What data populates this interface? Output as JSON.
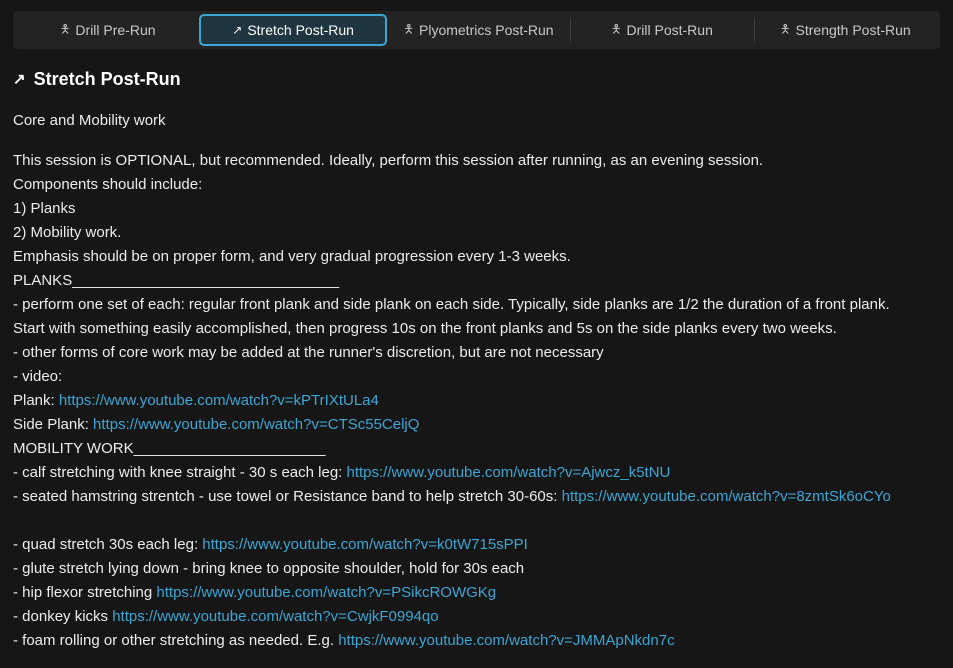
{
  "tabs": [
    {
      "label": "Drill Pre-Run",
      "icon": "runner-icon",
      "glyph": "🯅"
    },
    {
      "label": "Stretch Post-Run",
      "icon": "stretch-icon",
      "glyph": "↗"
    },
    {
      "label": "Plyometrics Post-Run",
      "icon": "jump-icon",
      "glyph": "🯅"
    },
    {
      "label": "Drill Post-Run",
      "icon": "runner-icon",
      "glyph": "🯅"
    },
    {
      "label": "Strength Post-Run",
      "icon": "weightlifter-icon",
      "glyph": "🯅"
    }
  ],
  "active_tab": 1,
  "heading": "Stretch Post-Run",
  "heading_icon": "stretch-icon",
  "subtitle": "Core and Mobility work",
  "lines": [
    {
      "text": "This session is OPTIONAL, but recommended. Ideally, perform this session after running, as an evening session."
    },
    {
      "text": "Components should include:"
    },
    {
      "text": "1) Planks"
    },
    {
      "text": "2) Mobility work."
    },
    {
      "text": "Emphasis should be on proper form, and very gradual progression every 1-3 weeks."
    },
    {
      "text": "PLANKS________________________________"
    },
    {
      "text": "- perform one set of each: regular front plank and side plank on each side. Typically, side planks are 1/2 the duration of a front plank."
    },
    {
      "text": "Start with something easily accomplished, then progress 10s on the front planks and 5s on the side planks every two weeks."
    },
    {
      "text": "- other forms of core work may be added at the runner's discretion, but are not necessary"
    },
    {
      "text": "- video:"
    },
    {
      "text": "Plank: ",
      "link": "https://www.youtube.com/watch?v=kPTrIXtULa4"
    },
    {
      "text": "Side Plank: ",
      "link": "https://www.youtube.com/watch?v=CTSc55CeljQ"
    },
    {
      "text": "MOBILITY WORK_______________________"
    },
    {
      "text": "- calf stretching with knee straight - 30 s each leg: ",
      "link": "https://www.youtube.com/watch?v=Ajwcz_k5tNU"
    },
    {
      "text": "- seated hamstring strentch - use towel or Resistance band to help stretch 30-60s: ",
      "link": "https://www.youtube.com/watch?v=8zmtSk6oCYo",
      "wrap": true
    },
    {
      "text": "- quad stretch 30s each leg: ",
      "link": "https://www.youtube.com/watch?v=k0tW715sPPI"
    },
    {
      "text": "- glute stretch lying down - bring knee to opposite shoulder, hold for 30s each"
    },
    {
      "text": "- hip flexor stretching ",
      "link": "https://www.youtube.com/watch?v=PSikcROWGKg"
    },
    {
      "text": "- donkey kicks ",
      "link": "https://www.youtube.com/watch?v=CwjkF0994qo"
    },
    {
      "text": "- foam rolling or other stretching as needed. E.g. ",
      "link": "https://www.youtube.com/watch?v=JMMApNkdn7c"
    }
  ],
  "colors": {
    "background": "#161616",
    "accent": "#3aa6d4",
    "tabbar": "#232323"
  }
}
